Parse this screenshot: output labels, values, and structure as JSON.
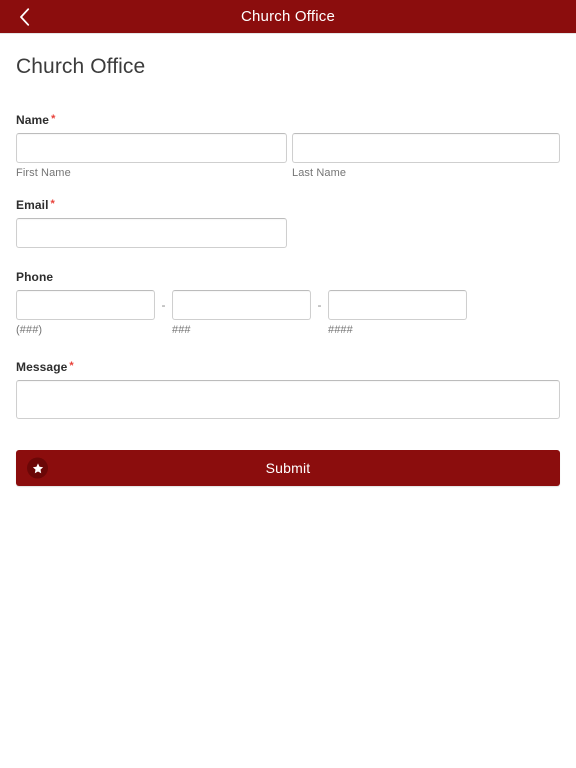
{
  "navbar": {
    "back_icon": "chevron-left-icon",
    "title": "Church Office"
  },
  "page": {
    "title": "Church Office"
  },
  "theme": {
    "brand_red": "#8B0D0D",
    "required_red": "#e8413a",
    "border_gray": "#cfcfcf",
    "sublabel_gray": "#757575"
  },
  "form": {
    "fields": [
      {
        "label": "Name",
        "required": true,
        "required_marker": "*",
        "inputs": [
          {
            "name": "first-name",
            "value": "",
            "placeholder": "",
            "sublabel": "First Name"
          },
          {
            "name": "last-name",
            "value": "",
            "placeholder": "",
            "sublabel": "Last Name"
          }
        ]
      },
      {
        "label": "Email",
        "required": true,
        "required_marker": "*",
        "inputs": [
          {
            "name": "email",
            "value": "",
            "placeholder": "",
            "sublabel": ""
          }
        ]
      },
      {
        "label": "Phone",
        "required": false,
        "required_marker": "",
        "separator": "-",
        "inputs": [
          {
            "name": "phone-area",
            "value": "",
            "placeholder": "",
            "sublabel": "(###)"
          },
          {
            "name": "phone-prefix",
            "value": "",
            "placeholder": "",
            "sublabel": "###"
          },
          {
            "name": "phone-line",
            "value": "",
            "placeholder": "",
            "sublabel": "####"
          }
        ]
      },
      {
        "label": "Message",
        "required": true,
        "required_marker": "*",
        "inputs": [
          {
            "name": "message",
            "value": "",
            "placeholder": "",
            "sublabel": ""
          }
        ]
      }
    ],
    "submit": {
      "label": "Submit",
      "icon": "star-icon"
    }
  }
}
